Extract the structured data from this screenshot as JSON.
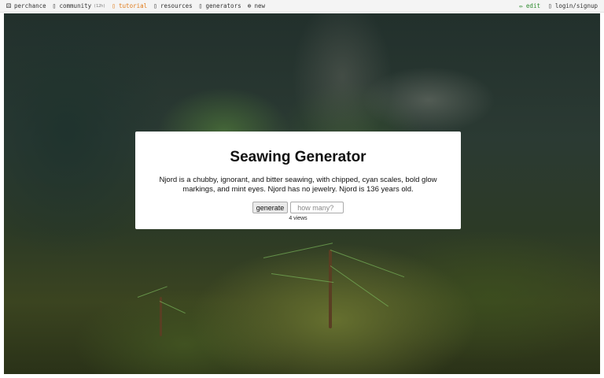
{
  "topbar": {
    "left_items": [
      {
        "icon": "dice-icon",
        "glyph": "⚄",
        "label": "perchance"
      },
      {
        "icon": "chat-icon",
        "glyph": "▯",
        "label": "community",
        "badge": "(12h)"
      },
      {
        "icon": "book-icon",
        "glyph": "▯",
        "label": "tutorial",
        "active": true
      },
      {
        "icon": "book-icon",
        "glyph": "▯",
        "label": "resources"
      },
      {
        "icon": "list-icon",
        "glyph": "▯",
        "label": "generators"
      },
      {
        "icon": "plus-icon",
        "glyph": "⊕",
        "label": "new"
      }
    ],
    "edit": {
      "icon": "pencil-icon",
      "glyph": "✏",
      "label": "edit"
    },
    "login": {
      "icon": "user-icon",
      "glyph": "▯",
      "label": "login/signup"
    }
  },
  "card": {
    "title": "Seawing Generator",
    "output": "Njord is a chubby, ignorant, and bitter seawing, with chipped, cyan scales, bold glow markings, and mint eyes. Njord has no jewelry. Njord is 136 years old.",
    "generate_label": "generate",
    "count_placeholder": "how many?",
    "views": "4 views"
  },
  "colors": {
    "active_nav": "#e07b1a",
    "edit_link": "#2e8b2e",
    "background_forest": "#2b3a33"
  }
}
